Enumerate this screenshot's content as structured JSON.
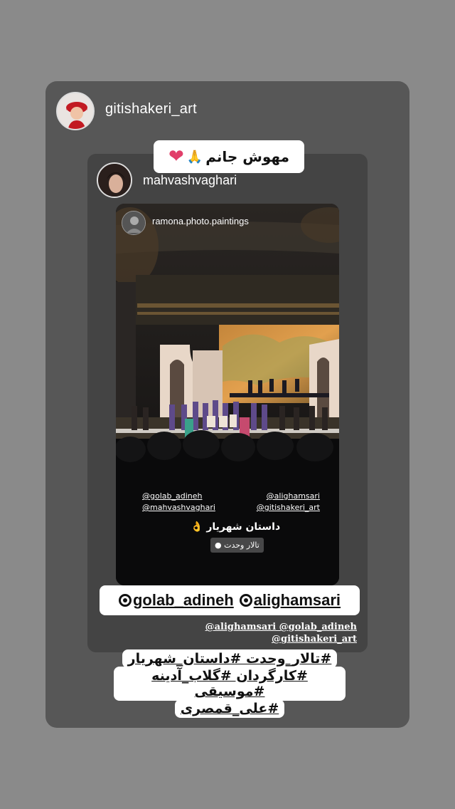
{
  "story": {
    "outer_username": "gitishakeri_art",
    "mid_username": "mahvashvaghari",
    "inner_username": "ramona.photo.paintings",
    "top_sticker": "مهوش جانم",
    "top_sticker_emoji_1": "🙏",
    "top_sticker_emoji_2": "❤",
    "mention_sticker": [
      "golab_adineh",
      "alighamsari"
    ],
    "small_mentions_line1": "@alighamsari @golab_adineh",
    "small_mentions_line2": "@gitishakeri_art",
    "photo_mention_1": "@golab_adineh",
    "photo_mention_2": "@alighamsari",
    "photo_mention_3": "@mahvashvaghari",
    "photo_mention_4": "@gitishakeri_art",
    "photo_title": "داستان شهریار",
    "photo_title_emoji": "👌",
    "photo_location": "تالار وحدت",
    "hashtag_line1": "#تالار_وحدت #داستان_شهریار",
    "hashtag_line2": "#کارگردان #گلاب_آدینه #موسیقی",
    "hashtag_line3": "#علی_قمصری"
  },
  "colors": {
    "background": "#8a8a8a",
    "outer_card": "#575757",
    "mid_card": "#444444",
    "heart": "#e13f6a"
  }
}
